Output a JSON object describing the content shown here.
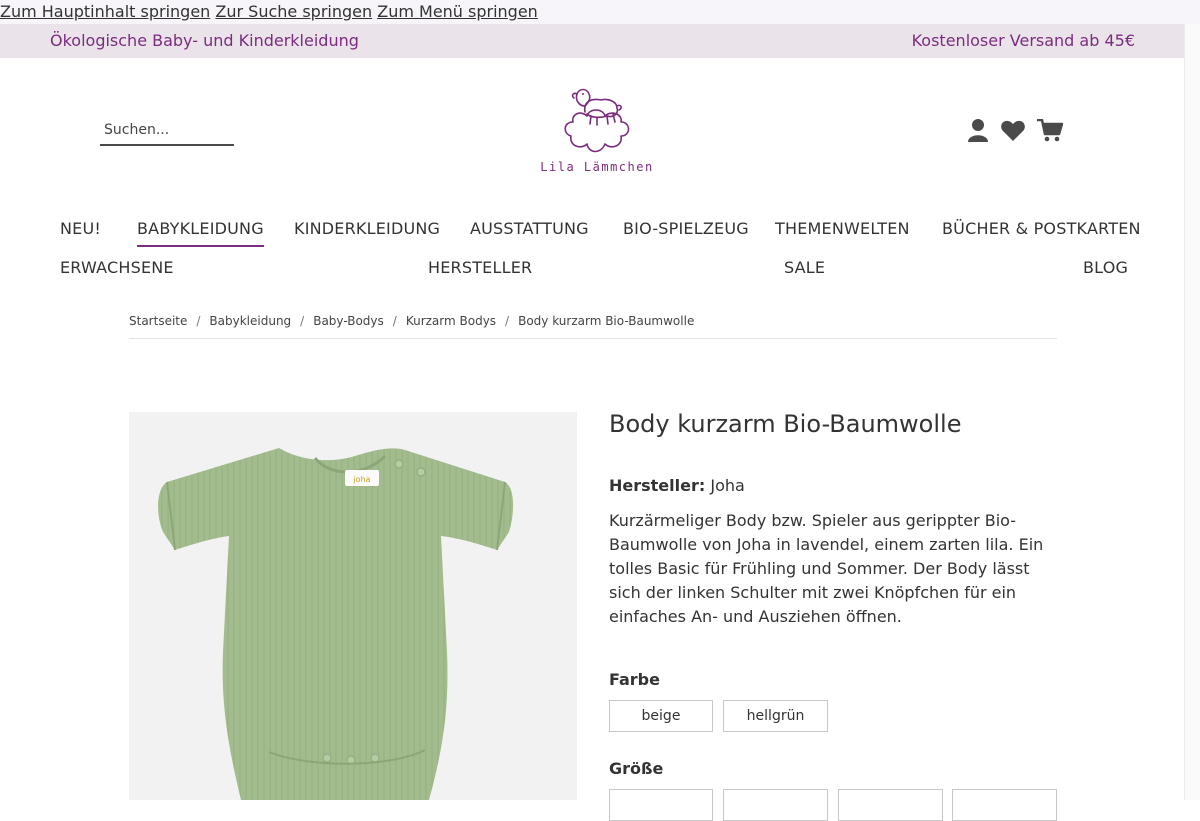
{
  "skip_links": [
    "Zum Hauptinhalt springen",
    "Zur Suche springen",
    "Zum Menü springen"
  ],
  "promo": {
    "left": "Ökologische Baby- und Kinderkleidung",
    "right": "Kostenloser Versand ab 45€"
  },
  "search": {
    "placeholder": "Suchen..."
  },
  "logo": {
    "text": "Lila Lämmchen"
  },
  "nav": {
    "row1": [
      "NEU!",
      "BABYKLEIDUNG",
      "KINDERKLEIDUNG",
      "AUSSTATTUNG",
      "BIO-SPIELZEUG",
      "THEMENWELTEN",
      "BÜCHER & POSTKARTEN"
    ],
    "row2": [
      "ERWACHSENE",
      "HERSTELLER",
      "SALE",
      "BLOG"
    ]
  },
  "breadcrumb": [
    "Startseite",
    "Babykleidung",
    "Baby-Bodys",
    "Kurzarm Bodys",
    "Body kurzarm Bio-Baumwolle"
  ],
  "product": {
    "title": "Body kurzarm Bio-Baumwolle",
    "manufacturer_label": "Hersteller:",
    "manufacturer": "Joha",
    "description": "Kurzärmeliger Body bzw. Spieler aus gerippter Bio-Baumwolle von Joha in lavendel, einem zarten lila. Ein tolles Basic für Frühling und Sommer. Der Body lässt sich der linken Schulter mit zwei Knöpfchen für ein einfaches An- und Ausziehen öffnen.",
    "color_label": "Farbe",
    "colors": [
      "beige",
      "hellgrün"
    ],
    "size_label": "Größe"
  },
  "colors": {
    "brand": "#7b2c7e",
    "promo_bg": "#eae3ea",
    "body_green": "#a3bc8e"
  },
  "icons": [
    "user-icon",
    "heart-icon",
    "cart-icon"
  ]
}
